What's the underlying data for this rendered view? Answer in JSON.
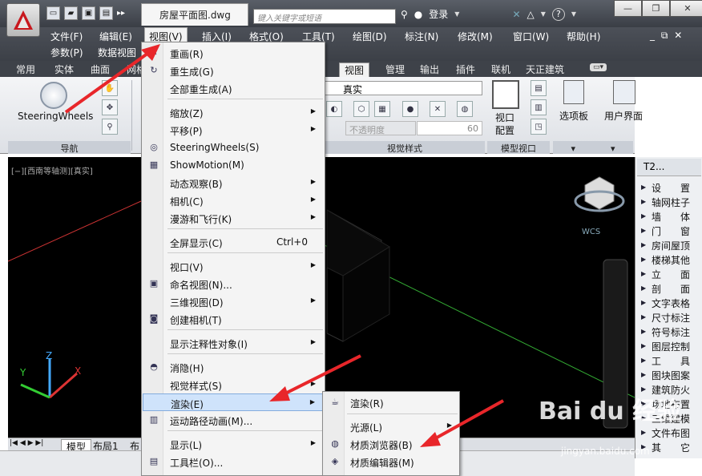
{
  "title_bar": {
    "document_title": "房屋平面图.dwg",
    "search_placeholder": "键入关键字或短语",
    "login_label": "登录",
    "help_label": "?",
    "more_label": "▸▸",
    "window_controls": {
      "minimize": "—",
      "restore": "❐",
      "close": "✕"
    }
  },
  "menubar": {
    "items": [
      "文件(F)",
      "编辑(E)",
      "视图(V)",
      "插入(I)",
      "格式(O)",
      "工具(T)",
      "绘图(D)",
      "标注(N)",
      "修改(M)",
      "窗口(W)",
      "帮助(H)"
    ],
    "items_row2": [
      "参数(P)",
      "数据视图"
    ],
    "active_index": 2,
    "mdi_controls": "_ ⧉ ✕"
  },
  "ribbon_tabs": {
    "items": [
      "常用",
      "实体",
      "曲面",
      "网格",
      "视图",
      "管理",
      "输出",
      "插件",
      "联机",
      "天正建筑"
    ],
    "active": "视图"
  },
  "ribbon": {
    "steering_label": "SteeringWheels",
    "nav_panel_label": "导航",
    "visual_style_value": "真实",
    "opacity_label": "不透明度",
    "opacity_value": "60",
    "visual_styles_panel_label": "视觉样式",
    "viewport_config_label_1": "视口",
    "viewport_config_label_2": "配置",
    "model_viewport_panel_label": "模型视口",
    "palette_label": "选项板",
    "ui_label": "用户界面"
  },
  "viewport": {
    "label": "[−][西南等轴测][真实]",
    "wcs_label": "WCS",
    "ucs_x": "X",
    "ucs_y": "Y",
    "ucs_z": "Z"
  },
  "bottom_tabs": [
    "模型",
    "布局1",
    "布"
  ],
  "tool_palette": {
    "title": "T2...",
    "items": [
      "设　　置",
      "轴网柱子",
      "墙　　体",
      "门　　窗",
      "房间屋顶",
      "楼梯其他",
      "立　　面",
      "剖　　面",
      "文字表格",
      "尺寸标注",
      "符号标注",
      "图层控制",
      "工　　具",
      "图块图案",
      "建筑防火",
      "场地布置",
      "三维建模",
      "文件布图",
      "其　　它"
    ]
  },
  "view_menu": {
    "items": [
      {
        "label": "重画(R)",
        "icon": "pencil-icon",
        "arrow": false,
        "shortcut": ""
      },
      {
        "label": "重生成(G)",
        "icon": "regen-icon",
        "arrow": false,
        "shortcut": ""
      },
      {
        "label": "全部重生成(A)",
        "icon": "",
        "arrow": false,
        "shortcut": ""
      },
      {
        "label": "缩放(Z)",
        "icon": "",
        "arrow": true,
        "shortcut": ""
      },
      {
        "label": "平移(P)",
        "icon": "",
        "arrow": true,
        "shortcut": ""
      },
      {
        "label": "SteeringWheels(S)",
        "icon": "wheel-icon",
        "arrow": false,
        "shortcut": ""
      },
      {
        "label": "ShowMotion(M)",
        "icon": "showmotion-icon",
        "arrow": false,
        "shortcut": ""
      },
      {
        "label": "动态观察(B)",
        "icon": "",
        "arrow": true,
        "shortcut": ""
      },
      {
        "label": "相机(C)",
        "icon": "",
        "arrow": true,
        "shortcut": ""
      },
      {
        "label": "漫游和飞行(K)",
        "icon": "",
        "arrow": true,
        "shortcut": ""
      },
      {
        "label": "全屏显示(C)",
        "icon": "",
        "arrow": false,
        "shortcut": "Ctrl+0"
      },
      {
        "label": "视口(V)",
        "icon": "",
        "arrow": true,
        "shortcut": ""
      },
      {
        "label": "命名视图(N)...",
        "icon": "named-view-icon",
        "arrow": false,
        "shortcut": ""
      },
      {
        "label": "三维视图(D)",
        "icon": "",
        "arrow": true,
        "shortcut": ""
      },
      {
        "label": "创建相机(T)",
        "icon": "camera-icon",
        "arrow": false,
        "shortcut": ""
      },
      {
        "label": "显示注释性对象(I)",
        "icon": "",
        "arrow": true,
        "shortcut": ""
      },
      {
        "label": "消隐(H)",
        "icon": "hide-icon",
        "arrow": false,
        "shortcut": ""
      },
      {
        "label": "视觉样式(S)",
        "icon": "",
        "arrow": true,
        "shortcut": ""
      },
      {
        "label": "渲染(E)",
        "icon": "",
        "arrow": true,
        "shortcut": ""
      },
      {
        "label": "运动路径动画(M)...",
        "icon": "motion-path-icon",
        "arrow": false,
        "shortcut": ""
      },
      {
        "label": "显示(L)",
        "icon": "",
        "arrow": true,
        "shortcut": ""
      },
      {
        "label": "工具栏(O)...",
        "icon": "toolbar-icon",
        "arrow": false,
        "shortcut": ""
      }
    ],
    "highlighted": "渲染(E)"
  },
  "render_submenu": {
    "items": [
      {
        "label": "渲染(R)",
        "icon": "teapot-icon",
        "arrow": false
      },
      {
        "label": "光源(L)",
        "icon": "",
        "arrow": true
      },
      {
        "label": "材质浏览器(B)",
        "icon": "material-browser-icon",
        "arrow": false
      },
      {
        "label": "材质编辑器(M)",
        "icon": "material-editor-icon",
        "arrow": false
      }
    ]
  },
  "watermark": {
    "text": "Bai du 经验",
    "url": "jingyan.baidu.com"
  },
  "colors": {
    "accent_red": "#e8262a",
    "menu_highlight": "#cfe3fb",
    "title_dark": "#3a3e45"
  }
}
